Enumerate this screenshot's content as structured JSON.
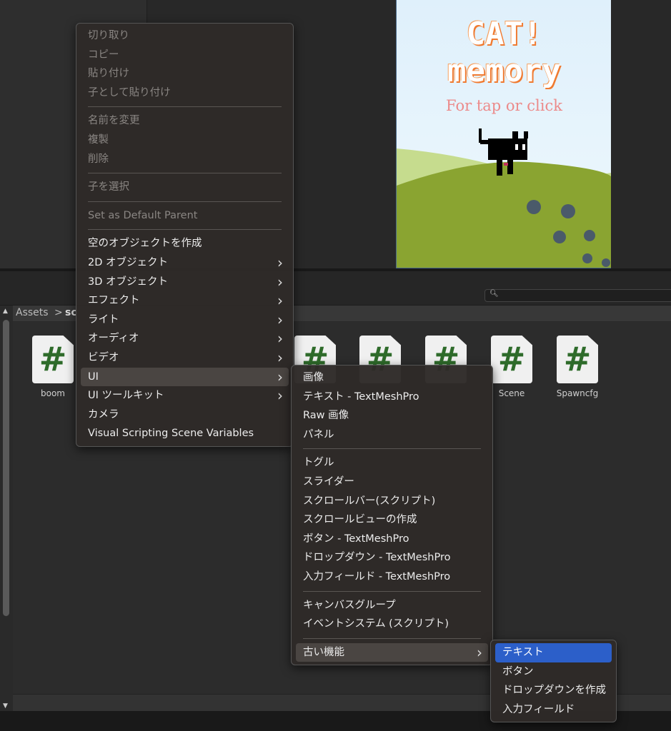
{
  "game": {
    "title_line1": "CAT!",
    "title_line2": "memory",
    "subtitle": "For tap or click"
  },
  "search": {
    "icon": "search-icon",
    "value": ""
  },
  "breadcrumb": {
    "root": "Assets",
    "sep": ">",
    "current": "sc"
  },
  "assets": [
    {
      "label": "boom"
    },
    {
      "label": ""
    },
    {
      "label": ""
    },
    {
      "label": ""
    },
    {
      "label": "Scene"
    },
    {
      "label": "Spawncfg"
    }
  ],
  "context_menu": {
    "groups": [
      [
        {
          "label": "切り取り",
          "disabled": true
        },
        {
          "label": "コピー",
          "disabled": true
        },
        {
          "label": "貼り付け",
          "disabled": true
        },
        {
          "label": "子として貼り付け",
          "disabled": true
        }
      ],
      [
        {
          "label": "名前を変更",
          "disabled": true
        },
        {
          "label": "複製",
          "disabled": true
        },
        {
          "label": "削除",
          "disabled": true
        }
      ],
      [
        {
          "label": "子を選択",
          "disabled": true
        }
      ],
      [
        {
          "label": "Set as Default Parent",
          "disabled": true
        }
      ],
      [
        {
          "label": "空のオブジェクトを作成"
        },
        {
          "label": "2D オブジェクト",
          "submenu": true
        },
        {
          "label": "3D オブジェクト",
          "submenu": true
        },
        {
          "label": "エフェクト",
          "submenu": true
        },
        {
          "label": "ライト",
          "submenu": true
        },
        {
          "label": "オーディオ",
          "submenu": true
        },
        {
          "label": "ビデオ",
          "submenu": true
        },
        {
          "label": "UI",
          "submenu": true,
          "highlighted": true
        },
        {
          "label": "UI ツールキット",
          "submenu": true
        },
        {
          "label": "カメラ"
        },
        {
          "label": "Visual Scripting Scene Variables"
        }
      ]
    ]
  },
  "ui_submenu": {
    "groups": [
      [
        {
          "label": "画像"
        },
        {
          "label": "テキスト - TextMeshPro"
        },
        {
          "label": "Raw 画像"
        },
        {
          "label": "パネル"
        }
      ],
      [
        {
          "label": "トグル"
        },
        {
          "label": "スライダー"
        },
        {
          "label": "スクロールバー(スクリプト)"
        },
        {
          "label": "スクロールビューの作成"
        },
        {
          "label": "ボタン - TextMeshPro"
        },
        {
          "label": "ドロップダウン - TextMeshPro"
        },
        {
          "label": "入力フィールド - TextMeshPro"
        }
      ],
      [
        {
          "label": "キャンバスグループ"
        },
        {
          "label": "イベントシステム (スクリプト)"
        }
      ],
      [
        {
          "label": "古い機能",
          "submenu": true,
          "highlighted": true
        }
      ]
    ]
  },
  "legacy_submenu": {
    "groups": [
      [
        {
          "label": "テキスト",
          "selected": true
        },
        {
          "label": "ボタン"
        },
        {
          "label": "ドロップダウンを作成"
        },
        {
          "label": "入力フィールド"
        }
      ]
    ]
  },
  "colors": {
    "selection": "#2c5fc9",
    "script_icon": "#2e6b2a"
  }
}
